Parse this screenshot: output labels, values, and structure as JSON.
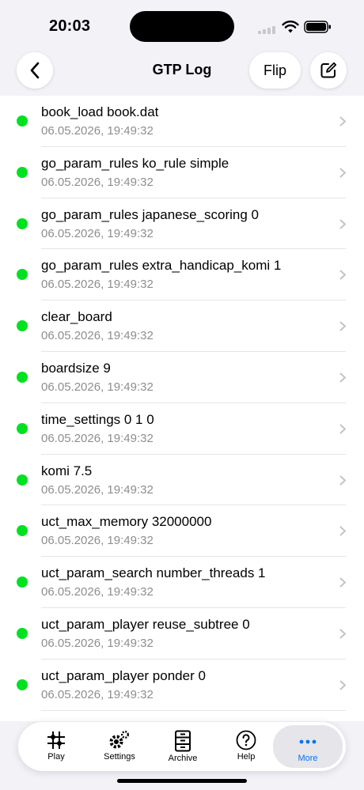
{
  "status_bar": {
    "time": "20:03"
  },
  "nav": {
    "title": "GTP Log",
    "flip_label": "Flip"
  },
  "log_entries": [
    {
      "command": "book_load book.dat",
      "timestamp": "06.05.2026, 19:49:32"
    },
    {
      "command": "go_param_rules ko_rule simple",
      "timestamp": "06.05.2026, 19:49:32"
    },
    {
      "command": "go_param_rules japanese_scoring 0",
      "timestamp": "06.05.2026, 19:49:32"
    },
    {
      "command": "go_param_rules extra_handicap_komi 1",
      "timestamp": "06.05.2026, 19:49:32"
    },
    {
      "command": "clear_board",
      "timestamp": "06.05.2026, 19:49:32"
    },
    {
      "command": "boardsize 9",
      "timestamp": "06.05.2026, 19:49:32"
    },
    {
      "command": "time_settings 0 1 0",
      "timestamp": "06.05.2026, 19:49:32"
    },
    {
      "command": "komi 7.5",
      "timestamp": "06.05.2026, 19:49:32"
    },
    {
      "command": "uct_max_memory 32000000",
      "timestamp": "06.05.2026, 19:49:32"
    },
    {
      "command": "uct_param_search number_threads 1",
      "timestamp": "06.05.2026, 19:49:32"
    },
    {
      "command": "uct_param_player reuse_subtree 0",
      "timestamp": "06.05.2026, 19:49:32"
    },
    {
      "command": "uct_param_player ponder 0",
      "timestamp": "06.05.2026, 19:49:32"
    }
  ],
  "tab_bar": {
    "tabs": [
      {
        "label": "Play",
        "icon": "play-grid-icon"
      },
      {
        "label": "Settings",
        "icon": "gears-icon"
      },
      {
        "label": "Archive",
        "icon": "archive-cabinet-icon"
      },
      {
        "label": "Help",
        "icon": "question-circle-icon"
      },
      {
        "label": "More",
        "icon": "ellipsis-icon"
      }
    ],
    "active": "More"
  },
  "colors": {
    "status_dot": "#00e21f",
    "accent": "#0a73ea"
  }
}
